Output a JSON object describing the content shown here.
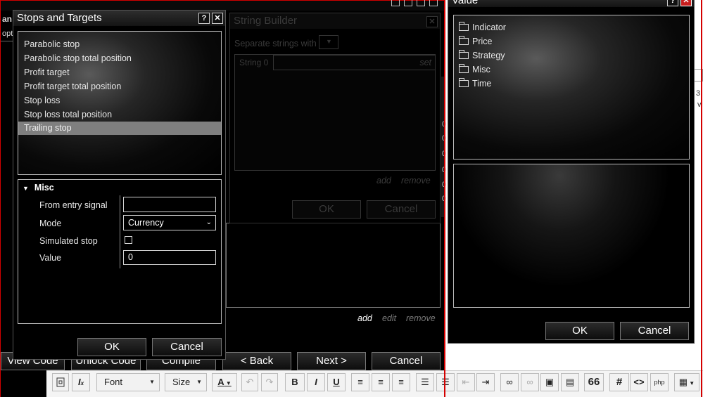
{
  "colors": {
    "dialog_bg": "#000000",
    "selection": "#7f7f7f",
    "border_red": "#d40000",
    "dim_text": "#3a3a3a",
    "link_dim": "#7a7a7a"
  },
  "background_window": {
    "partial_labels": [
      "an",
      "opt"
    ],
    "right_edge_chars": [
      "3",
      "v"
    ],
    "digit_column": [
      "0",
      "0",
      "0",
      "0",
      "0",
      "0"
    ],
    "links": {
      "add": "add",
      "edit": "edit",
      "remove": "remove"
    },
    "buttons": {
      "view_code": "View Code",
      "unlock_code": "Unlock Code",
      "compile": "Compile",
      "back": "< Back",
      "next": "Next >",
      "cancel": "Cancel"
    }
  },
  "editor_toolbar": {
    "font_select": "Font",
    "size_select": "Size",
    "icons": [
      "source-icon",
      "clear-format-icon",
      "text-color-icon",
      "undo-icon",
      "redo-icon",
      "bold-icon",
      "italic-icon",
      "underline-icon",
      "align-left-icon",
      "align-center-icon",
      "align-right-icon",
      "numbered-list-icon",
      "bullet-list-icon",
      "outdent-icon",
      "indent-icon",
      "link-icon",
      "unlink-icon",
      "image-icon",
      "media-icon",
      "quote-icon",
      "hash-icon",
      "code-icon",
      "php-icon",
      "table-icon"
    ],
    "labels": {
      "bold": "B",
      "italic": "I",
      "underline": "U",
      "quote": "66",
      "hash": "#",
      "code": "<>",
      "php": "php",
      "text_color": "A",
      "clear": "I"
    }
  },
  "string_builder": {
    "title": "String Builder",
    "separate_label": "Separate strings with",
    "string_row_label": "String 0",
    "set_link": "set",
    "add_link": "add",
    "remove_link": "remove",
    "ok": "OK",
    "cancel": "Cancel"
  },
  "stops_targets": {
    "title": "Stops and Targets",
    "help": "?",
    "items": [
      "Parabolic stop",
      "Parabolic stop total position",
      "Profit target",
      "Profit target total position",
      "Stop loss",
      "Stop loss total position",
      "Trailing stop"
    ],
    "selected_index": 6,
    "misc_header": "Misc",
    "props": {
      "from_entry_label": "From entry signal",
      "from_entry_value": "",
      "mode_label": "Mode",
      "mode_value": "Currency",
      "simulated_label": "Simulated stop",
      "simulated_checked": false,
      "value_label": "Value",
      "value_value": "0"
    },
    "ok": "OK",
    "cancel": "Cancel"
  },
  "value_dialog": {
    "title": "Value",
    "help": "?",
    "tree": [
      "Indicator",
      "Price",
      "Strategy",
      "Misc",
      "Time"
    ],
    "ok": "OK",
    "cancel": "Cancel"
  }
}
